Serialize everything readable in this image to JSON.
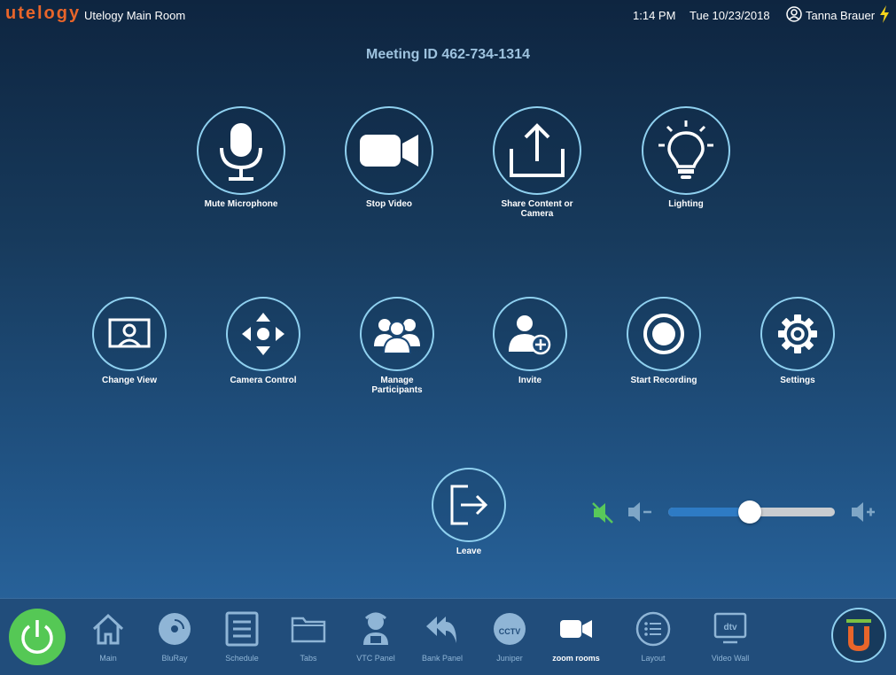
{
  "header": {
    "logo_text": "utelogy",
    "room_name": "Utelogy Main Room",
    "time": "1:14 PM",
    "date": "Tue 10/23/2018",
    "user_name": "Tanna Brauer"
  },
  "meeting": {
    "label": "Meeting ID 462-734-1314"
  },
  "controls": {
    "mute_microphone": "Mute Microphone",
    "stop_video": "Stop Video",
    "share_content_line1": "Share Content or",
    "share_content_line2": "Camera",
    "lighting": "Lighting",
    "change_view": "Change View",
    "camera_control": "Camera Control",
    "manage_line1": "Manage",
    "manage_line2": "Participants",
    "invite": "Invite",
    "start_recording": "Start Recording",
    "settings": "Settings",
    "leave": "Leave",
    "cctv_icon_text": "CCTV",
    "videowall_icon_text": "dtv"
  },
  "volume": {
    "level_percent": 49,
    "muted": true
  },
  "nav": {
    "main": "Main",
    "bluray": "BluRay",
    "schedule": "Schedule",
    "tabs": "Tabs",
    "vtc_panel": "VTC Panel",
    "bank_panel": "Bank Panel",
    "juniper": "Juniper",
    "zoom_rooms": "zoom rooms",
    "layout": "Layout",
    "video_wall": "Video Wall",
    "active": "zoom rooms"
  },
  "colors": {
    "accent_ring": "#8fd0ef",
    "logo_orange": "#e8652a",
    "power_green": "#55c855",
    "mute_green": "#58c85a",
    "bolt_yellow": "#f5d31c",
    "slider_fill": "#2e7bc4"
  },
  "icons": {
    "mute": "microphone-icon",
    "video": "video-camera-icon",
    "share": "upload-icon",
    "lighting": "lightbulb-icon",
    "view": "presenter-view-icon",
    "camera_control": "directional-pad-icon",
    "participants": "people-icon",
    "invite": "add-person-icon",
    "record": "record-icon",
    "settings": "gear-icon",
    "leave": "exit-icon"
  }
}
